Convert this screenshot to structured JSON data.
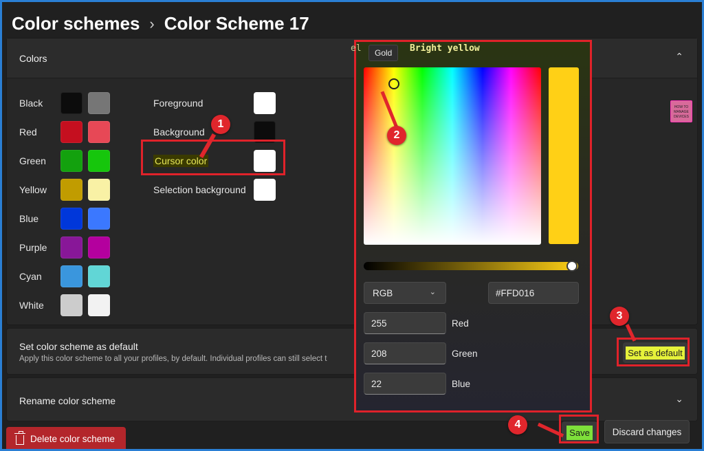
{
  "breadcrumb": {
    "parent": "Color schemes",
    "separator": "›",
    "current": "Color Scheme 17"
  },
  "colors_section": {
    "title": "Colors",
    "collapse_icon": "chevron-up-icon",
    "palette": [
      {
        "label": "Black",
        "normal": "#0c0c0c",
        "bright": "#767676"
      },
      {
        "label": "Red",
        "normal": "#c50f1f",
        "bright": "#e74856"
      },
      {
        "label": "Green",
        "normal": "#13a10e",
        "bright": "#16c60c"
      },
      {
        "label": "Yellow",
        "normal": "#c19c00",
        "bright": "#f9f1a5"
      },
      {
        "label": "Blue",
        "normal": "#0037da",
        "bright": "#3b78ff"
      },
      {
        "label": "Purple",
        "normal": "#881798",
        "bright": "#b4009e"
      },
      {
        "label": "Cyan",
        "normal": "#3a96dd",
        "bright": "#61d6d6"
      },
      {
        "label": "White",
        "normal": "#cccccc",
        "bright": "#f2f2f2"
      }
    ],
    "properties": [
      {
        "label": "Foreground",
        "color": "#ffffff"
      },
      {
        "label": "Background",
        "color": "#0c0c0c"
      },
      {
        "label": "Cursor color",
        "color": "#ffffff"
      },
      {
        "label": "Selection background",
        "color": "#ffffff"
      }
    ]
  },
  "color_picker": {
    "tooltip": "Gold",
    "header_fragment": "el",
    "header_label": "Bright yellow",
    "preview_color": "#ffd016",
    "mode": "RGB",
    "mode_icon": "chevron-down-icon",
    "hex": "#FFD016",
    "channels": [
      {
        "value": "255",
        "label": "Red"
      },
      {
        "value": "208",
        "label": "Green"
      },
      {
        "value": "22",
        "label": "Blue"
      }
    ]
  },
  "default_section": {
    "title": "Set color scheme as default",
    "description": "Apply this color scheme to all your profiles, by default. Individual profiles can still select t",
    "button": "Set as default"
  },
  "rename_section": {
    "title": "Rename color scheme",
    "expand_icon": "chevron-down-icon"
  },
  "footer": {
    "delete": "Delete color scheme",
    "delete_icon": "trash-icon",
    "save": "Save",
    "discard": "Discard changes"
  },
  "annotations": {
    "step1": "1",
    "step2": "2",
    "step3": "3",
    "step4": "4",
    "accent": "#e0222a"
  },
  "side_logo_text": "HOW TO MANAGE DEVICES"
}
